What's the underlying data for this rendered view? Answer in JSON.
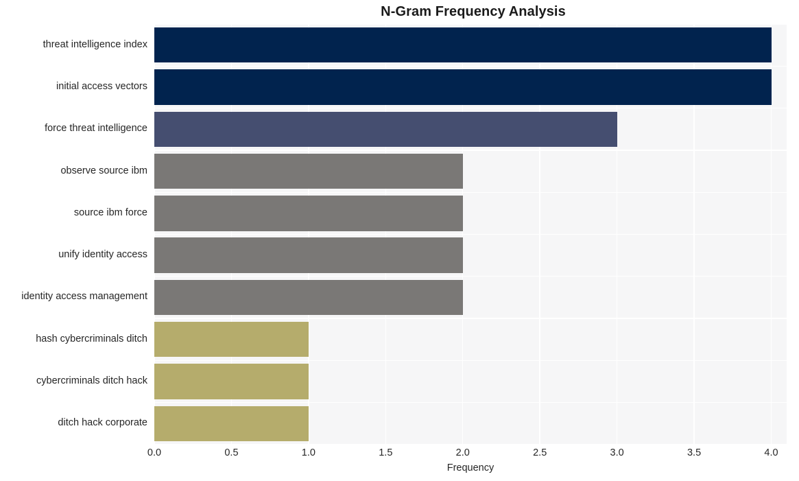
{
  "chart_data": {
    "type": "bar",
    "orientation": "horizontal",
    "title": "N-Gram Frequency Analysis",
    "xlabel": "Frequency",
    "ylabel": "",
    "categories": [
      "threat intelligence index",
      "initial access vectors",
      "force threat intelligence",
      "observe source ibm",
      "source ibm force",
      "unify identity access",
      "identity access management",
      "hash cybercriminals ditch",
      "cybercriminals ditch hack",
      "ditch hack corporate"
    ],
    "values": [
      4,
      4,
      3,
      2,
      2,
      2,
      2,
      1,
      1,
      1
    ],
    "bar_colors": [
      "#01234e",
      "#01234e",
      "#454e70",
      "#7a7876",
      "#7a7876",
      "#7a7876",
      "#7a7876",
      "#b5ac6c",
      "#b5ac6c",
      "#b5ac6c"
    ],
    "xlim": [
      0,
      4.1
    ],
    "xticks": [
      0,
      0.5,
      1,
      1.5,
      2,
      2.5,
      3,
      3.5,
      4
    ],
    "xtick_labels": [
      "0.0",
      "0.5",
      "1.0",
      "1.5",
      "2.0",
      "2.5",
      "3.0",
      "3.5",
      "4.0"
    ],
    "grid": true,
    "grid_color": "#ffffff",
    "legend": null,
    "plot_background": "#f6f6f7",
    "figure_background": "#ffffff",
    "title_color": "#1a1a1a",
    "tick_color": "#262626"
  }
}
